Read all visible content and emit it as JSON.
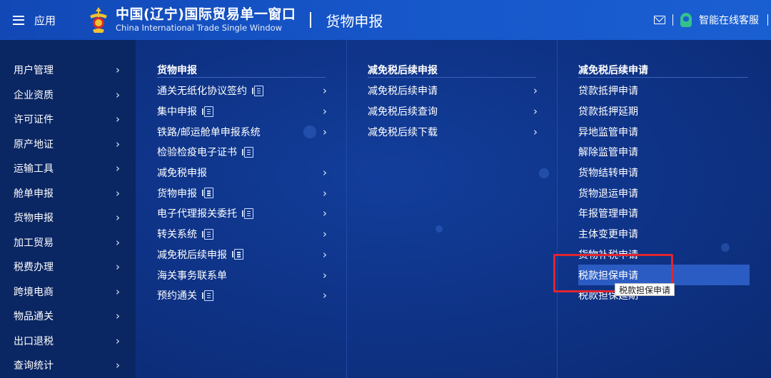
{
  "header": {
    "app_label": "应用",
    "brand_cn": "中国(辽宁)国际贸易单一窗口",
    "brand_en": "China International Trade Single Window",
    "page_title": "货物申报",
    "support_label": "智能在线客服"
  },
  "sidebar": {
    "items": [
      {
        "label": "用户管理"
      },
      {
        "label": "企业资质"
      },
      {
        "label": "许可证件"
      },
      {
        "label": "原产地证"
      },
      {
        "label": "运输工具"
      },
      {
        "label": "舱单申报"
      },
      {
        "label": "货物申报"
      },
      {
        "label": "加工贸易"
      },
      {
        "label": "税费办理"
      },
      {
        "label": "跨境电商"
      },
      {
        "label": "物品通关"
      },
      {
        "label": "出口退税"
      },
      {
        "label": "查询统计"
      }
    ]
  },
  "menu": {
    "col1": {
      "title": "货物申报",
      "items": [
        {
          "label": "通关无纸化协议签约",
          "doc": true,
          "chevron": true
        },
        {
          "label": "集中申报",
          "doc": true,
          "chevron": true
        },
        {
          "label": "铁路/邮运舱单申报系统",
          "doc": false,
          "chevron": true
        },
        {
          "label": "检验检疫电子证书",
          "doc": true,
          "chevron": false
        },
        {
          "label": "减免税申报",
          "doc": false,
          "chevron": true
        },
        {
          "label": "货物申报",
          "doc": true,
          "chevron": true
        },
        {
          "label": "电子代理报关委托",
          "doc": true,
          "chevron": true
        },
        {
          "label": "转关系统",
          "doc": true,
          "chevron": true
        },
        {
          "label": "减免税后续申报",
          "doc": true,
          "chevron": true
        },
        {
          "label": "海关事务联系单",
          "doc": false,
          "chevron": true
        },
        {
          "label": "预约通关",
          "doc": true,
          "chevron": true
        }
      ]
    },
    "col2": {
      "title": "减免税后续申报",
      "items": [
        {
          "label": "减免税后续申请"
        },
        {
          "label": "减免税后续查询"
        },
        {
          "label": "减免税后续下载"
        }
      ]
    },
    "col3": {
      "title": "减免税后续申请",
      "items": [
        {
          "label": "贷款抵押申请"
        },
        {
          "label": "贷款抵押延期"
        },
        {
          "label": "异地监管申请"
        },
        {
          "label": "解除监管申请"
        },
        {
          "label": "货物结转申请"
        },
        {
          "label": "货物退运申请"
        },
        {
          "label": "年报管理申请"
        },
        {
          "label": "主体变更申请"
        },
        {
          "label": "货物补税申请"
        },
        {
          "label": "税款担保申请"
        },
        {
          "label": "税款担保延期"
        }
      ]
    },
    "tooltip": "税款担保申请"
  },
  "colors": {
    "header_bg": "#1656c9",
    "sidebar_bg": "#0a2663",
    "highlight_row": "#2b5cc3",
    "highlight_border": "#e0252f"
  }
}
